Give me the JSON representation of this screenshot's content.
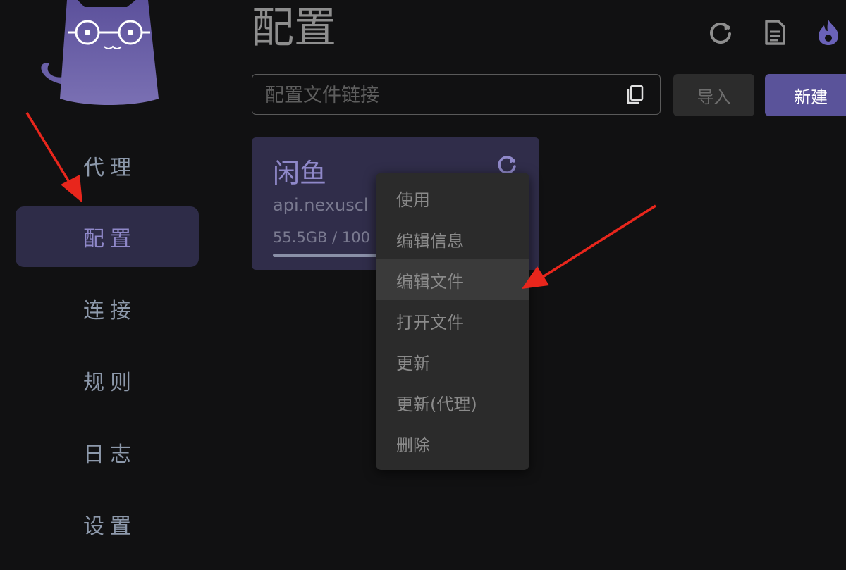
{
  "header": {
    "title": "配置",
    "icons": [
      "refresh-icon",
      "log-icon",
      "flame-icon"
    ]
  },
  "sidebar": {
    "logo": "cat-logo",
    "items": [
      {
        "label": "代理",
        "active": false
      },
      {
        "label": "配置",
        "active": true
      },
      {
        "label": "连接",
        "active": false
      },
      {
        "label": "规则",
        "active": false
      },
      {
        "label": "日志",
        "active": false
      },
      {
        "label": "设置",
        "active": false
      }
    ]
  },
  "import_bar": {
    "placeholder": "配置文件链接",
    "value": "",
    "copy_icon": "copy-icon",
    "import_label": "导入",
    "new_label": "新建"
  },
  "profile": {
    "name": "闲鱼",
    "url": "api.nexuscl",
    "usage": "55.5GB / 100",
    "usage_fraction": 0.555,
    "refresh_icon": "refresh-icon"
  },
  "context_menu": {
    "items": [
      {
        "label": "使用"
      },
      {
        "label": "编辑信息"
      },
      {
        "label": "编辑文件",
        "highlighted": true
      },
      {
        "label": "打开文件"
      },
      {
        "label": "更新"
      },
      {
        "label": "更新(代理)"
      },
      {
        "label": "删除"
      }
    ]
  },
  "colors": {
    "background": "#111112",
    "accent": "#5a539a",
    "sidebar_active_bg": "#2e2c48",
    "card_bg": "#302d4a",
    "menu_bg": "#2b2b2b",
    "annotation_arrow": "#e8261c"
  }
}
